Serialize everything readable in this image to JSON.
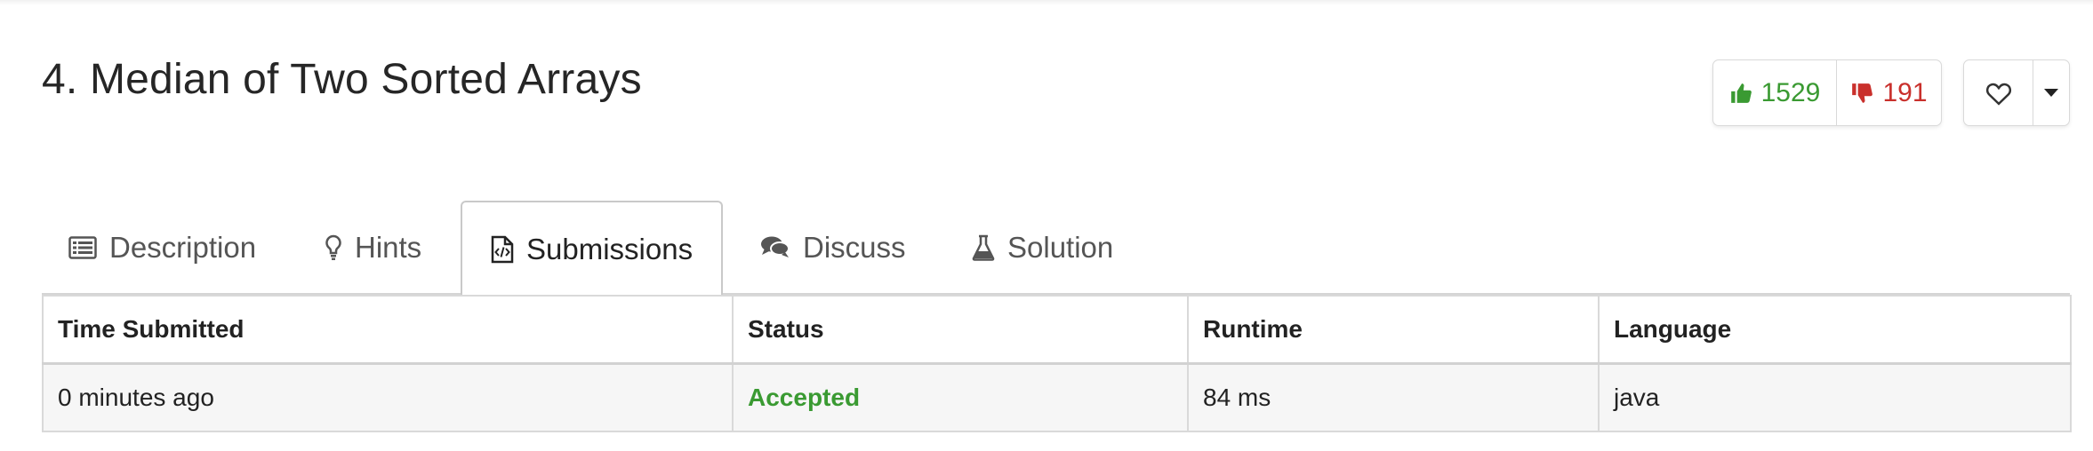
{
  "problem": {
    "title": "4. Median of Two Sorted Arrays"
  },
  "votes": {
    "likes": "1529",
    "dislikes": "191",
    "like_color": "#3a9a32",
    "dislike_color": "#c9302c",
    "like_icon": "thumbs-up-icon",
    "dislike_icon": "thumbs-down-icon",
    "favorite_icon": "heart-icon",
    "menu_icon": "caret-down-icon"
  },
  "tabs": [
    {
      "label": "Description",
      "icon": "list-icon",
      "active": false
    },
    {
      "label": "Hints",
      "icon": "lightbulb-icon",
      "active": false
    },
    {
      "label": "Submissions",
      "icon": "code-file-icon",
      "active": true
    },
    {
      "label": "Discuss",
      "icon": "comments-icon",
      "active": false
    },
    {
      "label": "Solution",
      "icon": "flask-icon",
      "active": false
    }
  ],
  "submissions": {
    "columns": [
      "Time Submitted",
      "Status",
      "Runtime",
      "Language"
    ],
    "rows": [
      {
        "time": "0 minutes ago",
        "status": "Accepted",
        "runtime": "84 ms",
        "language": "java"
      }
    ],
    "accepted_color": "#3a9a32"
  }
}
